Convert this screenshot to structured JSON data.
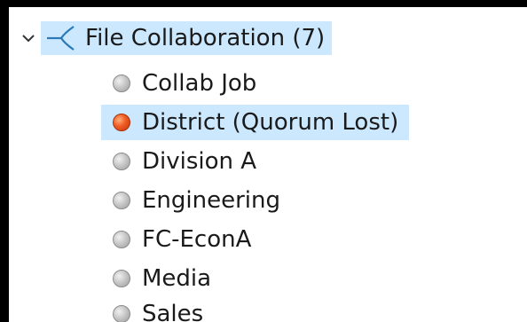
{
  "tree": {
    "group": {
      "label": "File Collaboration (7)",
      "expanded": true,
      "chevron_icon": "chevron-down-icon",
      "group_icon": "cluster-branch-icon",
      "accent_color": "#2a7ab8"
    },
    "items": [
      {
        "label": "Collab Job",
        "status": "grey",
        "selected": false
      },
      {
        "label": "District (Quorum Lost)",
        "status": "red",
        "selected": true
      },
      {
        "label": "Division A",
        "status": "grey",
        "selected": false
      },
      {
        "label": "Engineering",
        "status": "grey",
        "selected": false
      },
      {
        "label": "FC-EconA",
        "status": "grey",
        "selected": false
      },
      {
        "label": "Media",
        "status": "grey",
        "selected": false
      },
      {
        "label": "Sales",
        "status": "grey",
        "selected": false
      }
    ],
    "selection_color": "#cce8ff",
    "status_colors": {
      "grey": "#bdbdbd",
      "red": "#f05a23"
    }
  }
}
